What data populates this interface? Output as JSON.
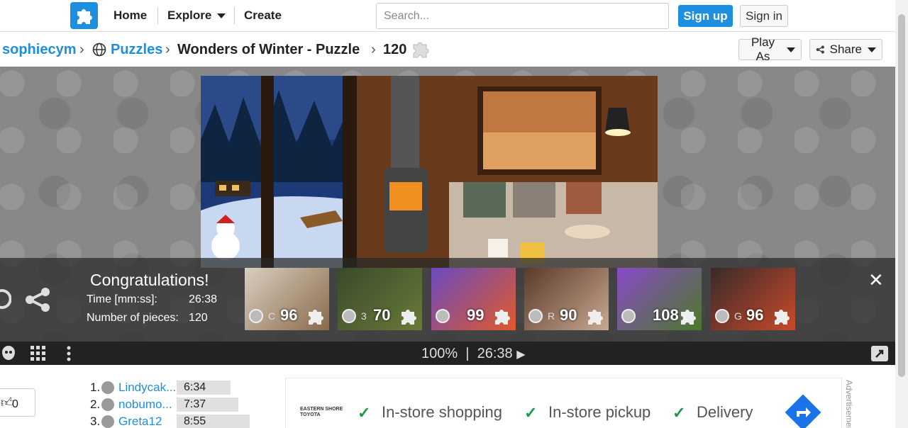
{
  "nav": {
    "home": "Home",
    "explore": "Explore",
    "create": "Create",
    "search_placeholder": "Search...",
    "signup": "Sign up",
    "signin": "Sign in"
  },
  "breadcrumb": {
    "user": "sophiecym",
    "section": "Puzzles",
    "title": "Wonders of Winter - Puzzle",
    "pieces": "120"
  },
  "actions": {
    "play_as": "Play As",
    "share": "Share"
  },
  "completion": {
    "heading": "Congratulations!",
    "time_label": "Time [mm:ss]:",
    "time_value": "26:38",
    "pieces_label": "Number of pieces:",
    "pieces_value": "120"
  },
  "suggestions": [
    {
      "letter": "C",
      "count": "96",
      "colors": [
        "#d9cfc0",
        "#8a6a4a"
      ]
    },
    {
      "letter": "3",
      "count": "70",
      "colors": [
        "#3a4a2a",
        "#6a7a3a"
      ]
    },
    {
      "letter": "",
      "count": "99",
      "colors": [
        "#6a4ac0",
        "#e05a2a"
      ]
    },
    {
      "letter": "R",
      "count": "90",
      "colors": [
        "#5a3a2a",
        "#c8a890"
      ]
    },
    {
      "letter": "",
      "count": "108",
      "colors": [
        "#8a4ac8",
        "#4a7a2a"
      ]
    },
    {
      "letter": "G",
      "count": "96",
      "colors": [
        "#3a2a2a",
        "#c84a2a"
      ]
    }
  ],
  "controls": {
    "zoom": "100%",
    "separator": "|",
    "timer": "26:38"
  },
  "likes": {
    "count": "0"
  },
  "leaderboard": [
    {
      "rank": "1.",
      "name": "Lindycak...",
      "time": "6:34"
    },
    {
      "rank": "2.",
      "name": "nobumo...",
      "time": "7:37"
    },
    {
      "rank": "3.",
      "name": "Greta12",
      "time": "8:55"
    }
  ],
  "ad": {
    "brand": "EASTERN SHORE TOYOTA",
    "items": [
      "In-store shopping",
      "In-store pickup",
      "Delivery"
    ],
    "label": "Advertisement"
  }
}
